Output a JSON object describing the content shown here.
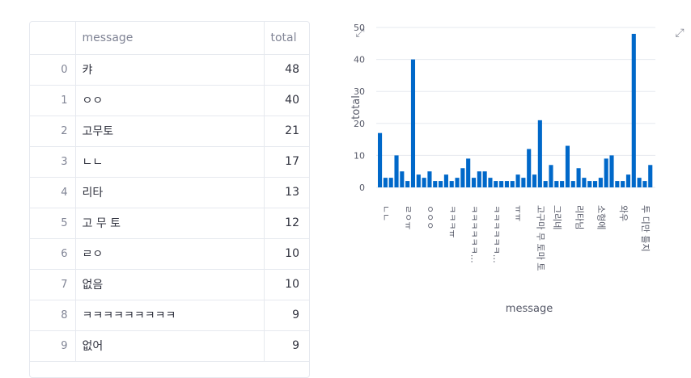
{
  "table": {
    "columns": [
      "",
      "message",
      "total"
    ],
    "rows": [
      {
        "index": "0",
        "message": "캬",
        "total": "48"
      },
      {
        "index": "1",
        "message": "ㅇㅇ",
        "total": "40"
      },
      {
        "index": "2",
        "message": "고무토",
        "total": "21"
      },
      {
        "index": "3",
        "message": "ㄴㄴ",
        "total": "17"
      },
      {
        "index": "4",
        "message": "리타",
        "total": "13"
      },
      {
        "index": "5",
        "message": "고 무 토",
        "total": "12"
      },
      {
        "index": "6",
        "message": "ㄹㅇ",
        "total": "10"
      },
      {
        "index": "7",
        "message": "없음",
        "total": "10"
      },
      {
        "index": "8",
        "message": "ㅋㅋㅋㅋㅋㅋㅋㅋㅋ",
        "total": "9"
      },
      {
        "index": "9",
        "message": "없어",
        "total": "9"
      }
    ]
  },
  "icons": {
    "expand": "expand-icon"
  },
  "chart_data": {
    "type": "bar",
    "title": "",
    "xlabel": "message",
    "ylabel": "total",
    "ylim": [
      0,
      50
    ],
    "yticks": [
      0,
      10,
      20,
      30,
      40,
      50
    ],
    "grid": true,
    "color": "#0068c9",
    "visible_tick_labels": [
      "ㄴㄴ",
      "ㄹㅇㅠ",
      "ㅇㅇㅇ",
      "ㅋㅋㅋㅠ",
      "ㅋㅋㅋㅋㅋㅋ…",
      "ㅋㅋㅋㅋㅋㅋ…",
      "ㅠㅠ",
      "고구마 무 토마 토",
      "그리네",
      "리타님",
      "소형에",
      "와우",
      "투 디만 틀지"
    ],
    "values": [
      17,
      3,
      3,
      10,
      5,
      2,
      40,
      4,
      3,
      5,
      2,
      2,
      4,
      2,
      3,
      6,
      9,
      3,
      5,
      5,
      3,
      2,
      2,
      2,
      2,
      4,
      3,
      12,
      4,
      21,
      2,
      7,
      2,
      2,
      13,
      2,
      6,
      3,
      2,
      2,
      3,
      9,
      10,
      2,
      2,
      4,
      48,
      3,
      2,
      7
    ]
  }
}
